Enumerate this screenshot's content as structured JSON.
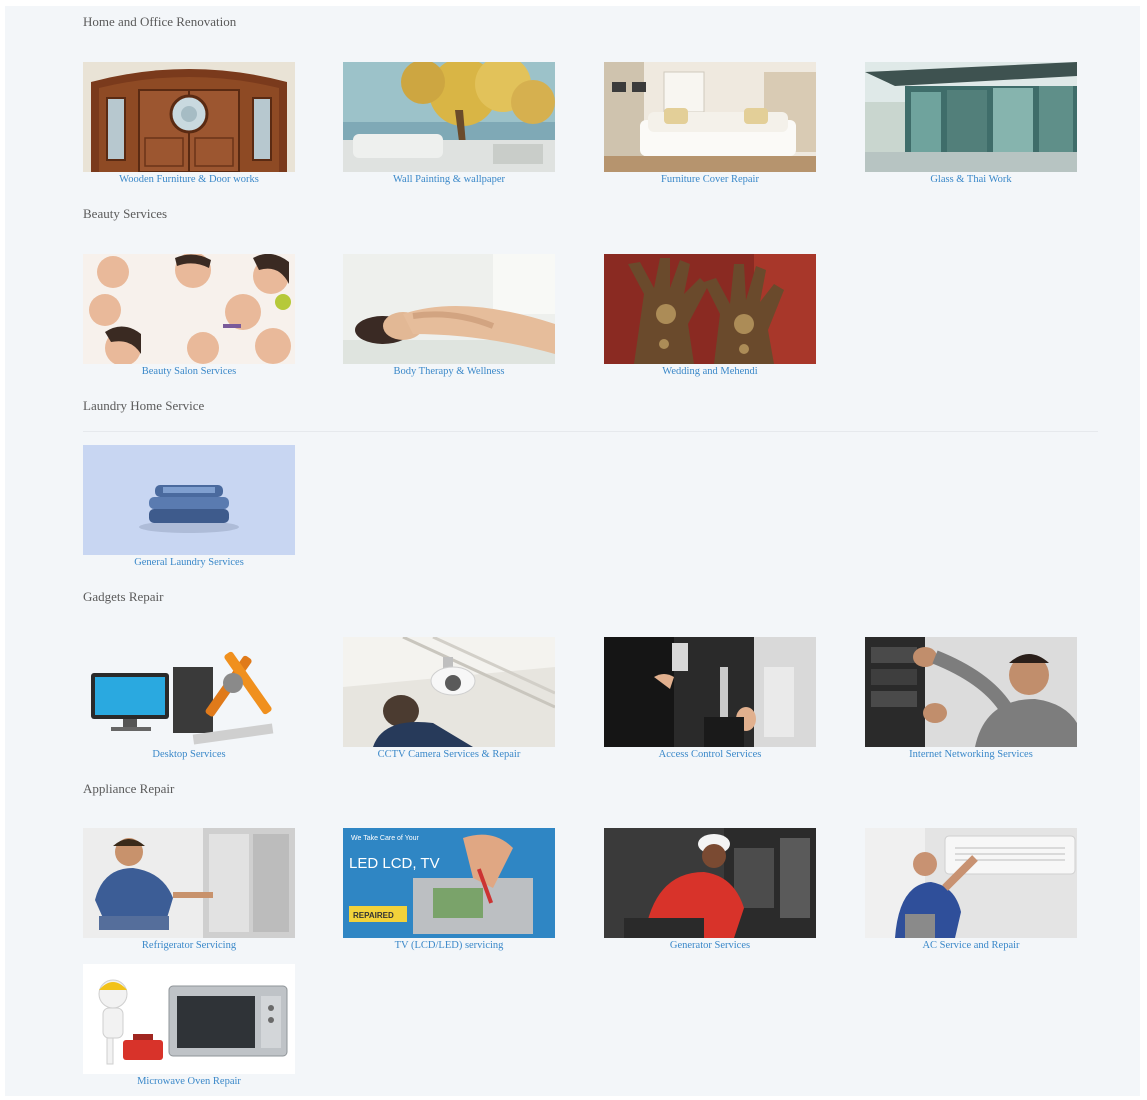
{
  "colors": {
    "page_bg": "#f3f6f9",
    "caption_link": "#3a88c9",
    "section_heading": "#5a5a5a"
  },
  "sections": [
    {
      "title": "Home and Office Renovation",
      "items": [
        {
          "label": "Wooden Furniture & Door works",
          "icon": "wooden-door-image"
        },
        {
          "label": "Wall Painting & wallpaper",
          "icon": "wall-painting-image"
        },
        {
          "label": "Furniture Cover Repair",
          "icon": "sofa-image"
        },
        {
          "label": "Glass & Thai Work",
          "icon": "glass-building-image"
        }
      ]
    },
    {
      "title": "Beauty Services",
      "items": [
        {
          "label": "Beauty Salon Services",
          "icon": "beauty-faces-image"
        },
        {
          "label": "Body Therapy & Wellness",
          "icon": "massage-image"
        },
        {
          "label": "Wedding and Mehendi",
          "icon": "mehendi-hands-image"
        }
      ]
    },
    {
      "title": "Laundry Home Service",
      "items": [
        {
          "label": "General Laundry Services",
          "icon": "folded-clothes-image"
        }
      ]
    },
    {
      "title": "Gadgets Repair",
      "items": [
        {
          "label": "Desktop Services",
          "icon": "desktop-tools-image"
        },
        {
          "label": "CCTV Camera Services & Repair",
          "icon": "cctv-camera-image"
        },
        {
          "label": "Access Control Services",
          "icon": "access-control-image"
        },
        {
          "label": "Internet Networking Services",
          "icon": "network-technician-image"
        }
      ]
    },
    {
      "title": "Appliance Repair",
      "items": [
        {
          "label": "Refrigerator Servicing",
          "icon": "refrigerator-repair-image"
        },
        {
          "label": "TV (LCD/LED) servicing",
          "icon": "tv-repair-image"
        },
        {
          "label": "Generator Services",
          "icon": "generator-repair-image"
        },
        {
          "label": "AC Service and Repair",
          "icon": "ac-repair-image"
        },
        {
          "label": "Microwave Oven Repair",
          "icon": "microwave-repair-image"
        }
      ]
    }
  ],
  "tv_banner": {
    "line1": "We Take Care of Your",
    "line2": "LED LCD, TV",
    "tag": "REPAIRED"
  }
}
